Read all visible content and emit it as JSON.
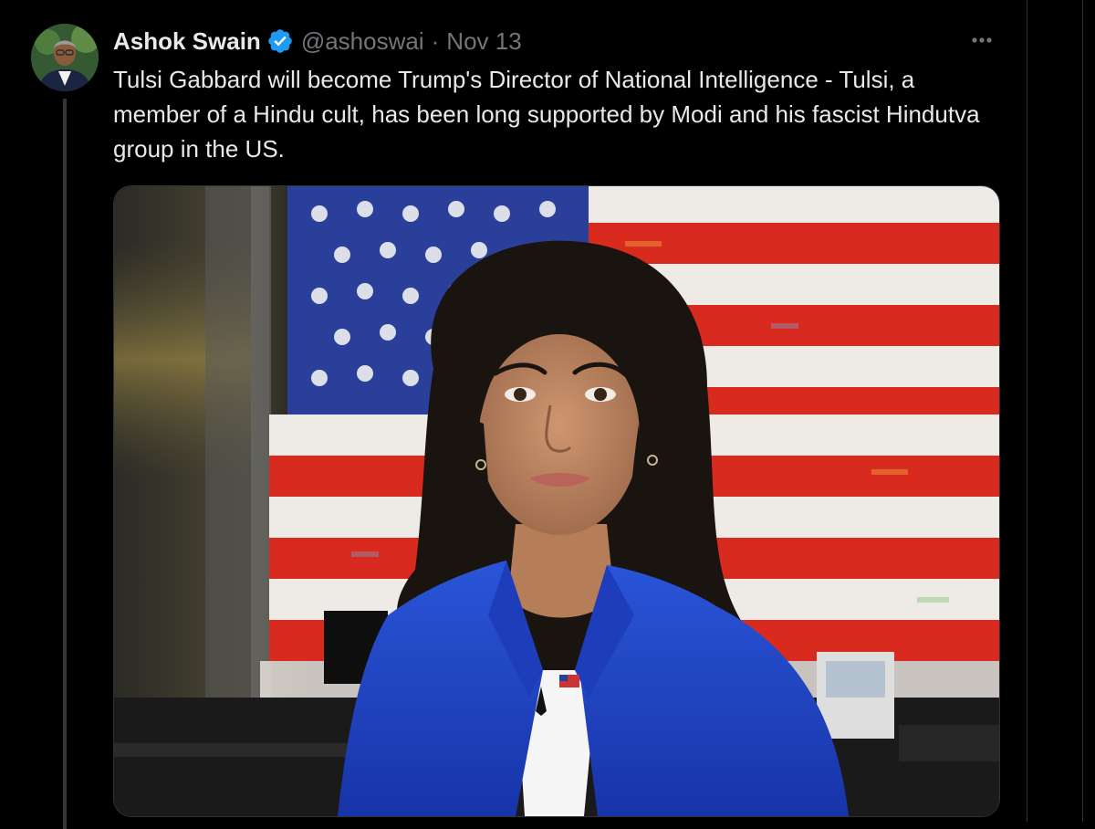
{
  "tweet": {
    "author_name": "Ashok Swain",
    "handle": "@ashoswai",
    "separator": "·",
    "timestamp": "Nov 13",
    "text": "Tulsi Gabbard will become Trump's Director of National Intelligence - Tulsi, a member of a Hindu cult, has been long supported by Modi and his fascist Hindutva group in the US.",
    "verified_badge_color": "#1d9bf0",
    "more_icon": "more-horizontal-icon"
  },
  "colors": {
    "background": "#000000",
    "text_primary": "#e7e9ea",
    "text_secondary": "#71767b",
    "border": "#2f3336",
    "jacket_blue": "#1f44c4",
    "flag_red": "#d92a1f",
    "flag_blue": "#2a3f9a"
  }
}
